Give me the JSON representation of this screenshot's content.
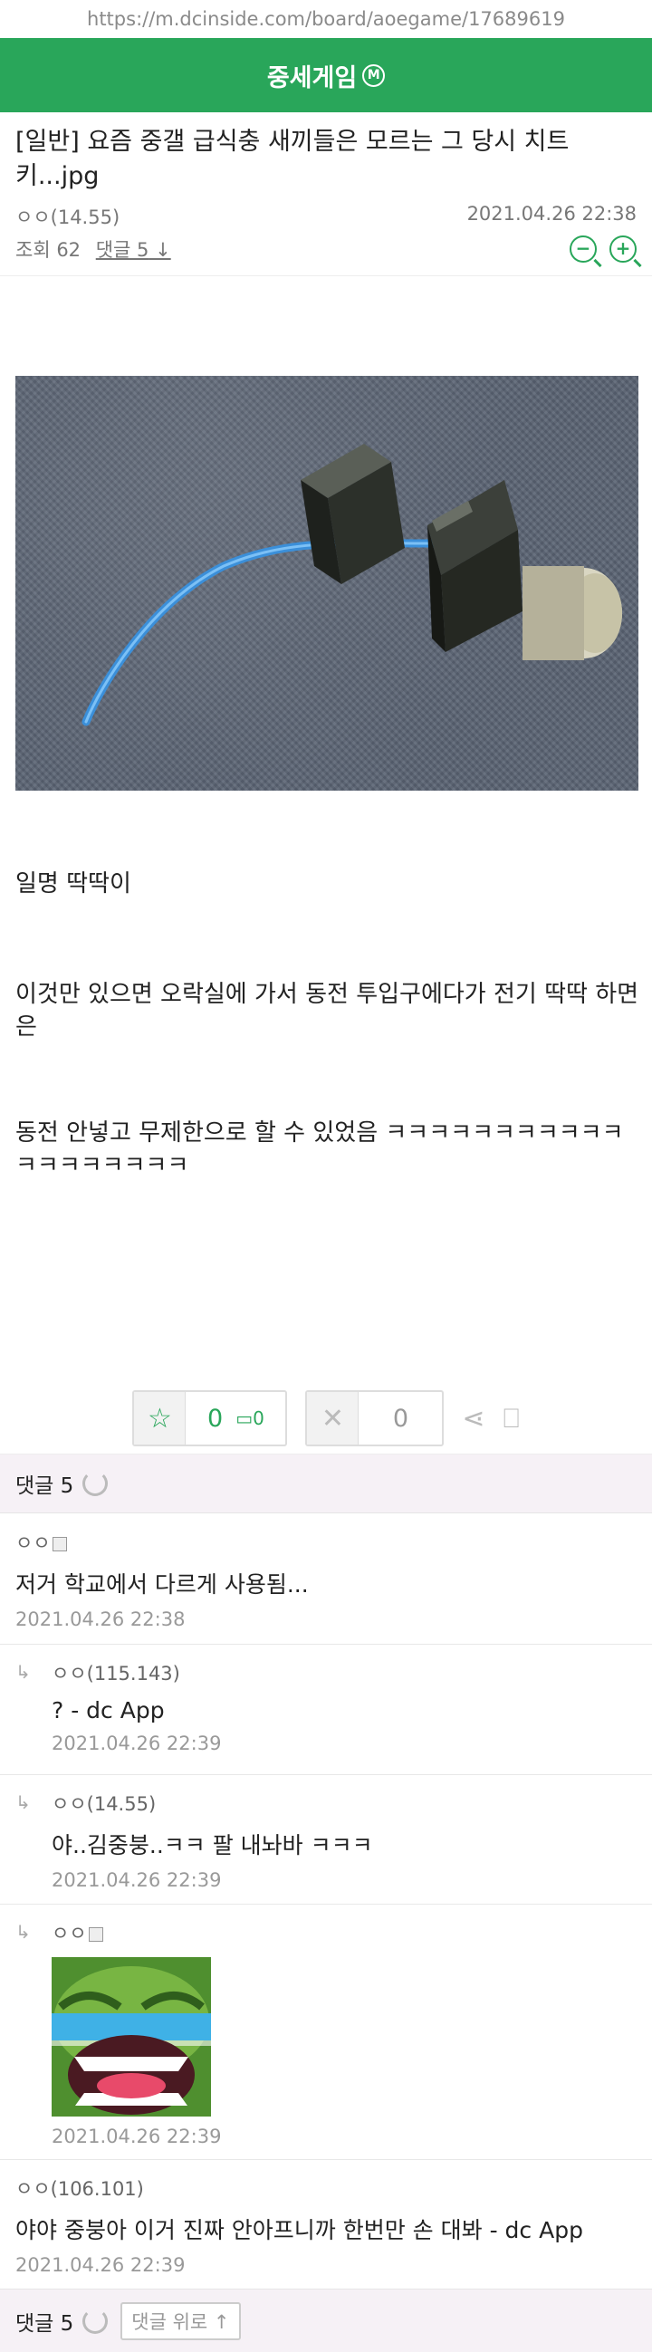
{
  "url": "https://m.dcinside.com/board/aoegame/17689619",
  "gallery": {
    "name": "중세게임",
    "badge": "M"
  },
  "post": {
    "title": "[일반] 요즘 중갤 급식충 새끼들은 모르는 그 당시 치트키...jpg",
    "author": "ㅇㅇ(14.55)",
    "date": "2021.04.26 22:38",
    "views": "조회 62",
    "comments_link": "댓글 5",
    "paragraphs": [
      "일명 딱딱이",
      "이것만 있으면 오락실에 가서 동전 투입구에다가 전기 딱딱 하면은",
      "동전 안넣고 무제한으로 할 수 있었음 ㅋㅋㅋㅋㅋㅋㅋㅋㅋㅋㅋㅋㅋㅋㅋㅋㅋㅋㅋ"
    ]
  },
  "votes": {
    "up": "0",
    "fixed_up": "0",
    "down": "0"
  },
  "comment_header": {
    "label": "댓글 5"
  },
  "comments": [
    {
      "name": "ㅇㅇ",
      "text": "저거 학교에서 다르게 사용됨...",
      "date": "2021.04.26 22:38"
    },
    {
      "name": "ㅇㅇ(115.143)",
      "text": "? - dc App",
      "date": "2021.04.26 22:39"
    },
    {
      "name": "ㅇㅇ(14.55)",
      "text": "야..김중붕..ㅋㅋ 팔 내놔바 ㅋㅋㅋ",
      "date": "2021.04.26 22:39"
    },
    {
      "name": "ㅇㅇ",
      "text": "",
      "date": "2021.04.26 22:39"
    },
    {
      "name": "ㅇㅇ(106.101)",
      "text": "야야 중붕아 이거 진짜 안아프니까 한번만 손 대봐 - dc App",
      "date": "2021.04.26 22:39"
    }
  ],
  "footer": {
    "comments": "댓글 5",
    "scroll_top": "댓글 위로"
  },
  "colors": {
    "brand": "#29a65a"
  }
}
